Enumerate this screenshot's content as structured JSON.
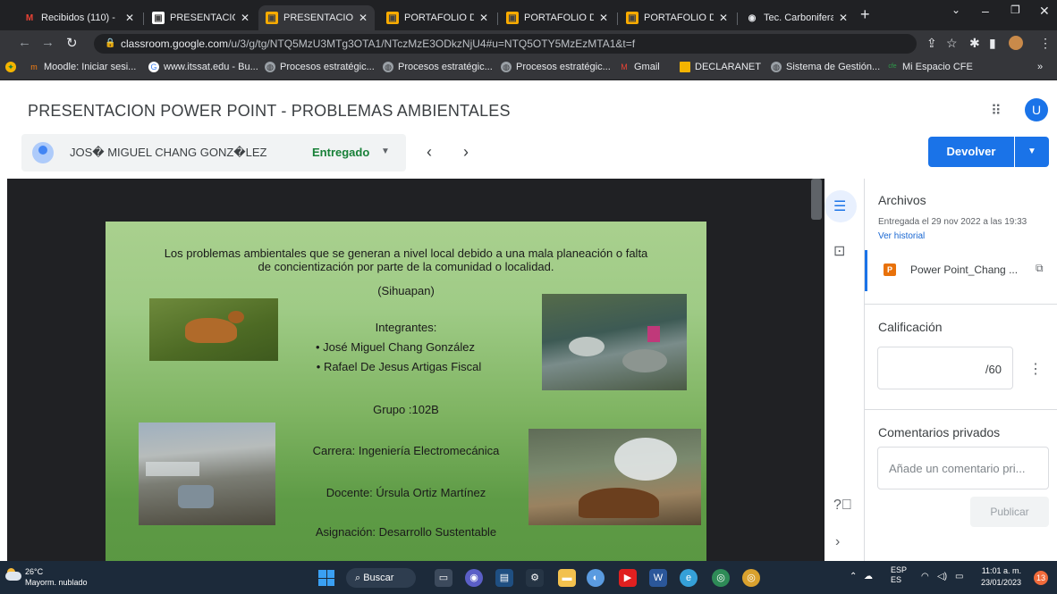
{
  "browser": {
    "tabs": [
      {
        "label": "Recibidos (110) -",
        "icon": "gmail-icon"
      },
      {
        "label": "PRESENTACION I",
        "icon": "slides-icon"
      },
      {
        "label": "PRESENTACION I",
        "icon": "slides-icon"
      },
      {
        "label": "PORTAFOLIO DE",
        "icon": "slides-icon"
      },
      {
        "label": "PORTAFOLIO DE",
        "icon": "slides-icon"
      },
      {
        "label": "PORTAFOLIO DE",
        "icon": "slides-icon"
      },
      {
        "label": "Tec. Carbonifera",
        "icon": "globe-icon"
      }
    ],
    "url_host": "classroom.google.com",
    "url_path": "/u/3/g/tg/NTQ5MzU3MTg3OTA1/NTczMzE3ODkzNjU4#u=NTQ5OTY5MzEzMTA1&t=f",
    "bookmarks": [
      "Moodle: Iniciar sesi...",
      "www.itssat.edu - Bu...",
      "Procesos estratégic...",
      "Procesos estratégic...",
      "Procesos estratégic...",
      "Gmail",
      "DECLARANET",
      "Sistema de Gestión...",
      "Mi Espacio CFE"
    ]
  },
  "classroom": {
    "title": "PRESENTACION POWER POINT - PROBLEMAS AMBIENTALES",
    "avatar_letter": "U",
    "student_name": "JOS� MIGUEL CHANG GONZ�LEZ",
    "status": "Entregado",
    "return_button": "Devolver"
  },
  "slide": {
    "intro": "Los problemas ambientales que se generan a nivel local debido a una mala planeación o falta de concientización por parte de la comunidad o localidad.",
    "place": "(Sihuapan)",
    "members_heading": "Integrantes:",
    "members": [
      "José Miguel Chang González",
      "Rafael De Jesus Artigas Fiscal"
    ],
    "group": "Grupo :102B",
    "career": "Carrera: Ingeniería Electromecánica",
    "teacher": "Docente: Úrsula Ortiz Martínez",
    "subject": "Asignación: Desarrollo Sustentable"
  },
  "panel": {
    "files_heading": "Archivos",
    "submitted_date": "Entregada el 29 nov 2022 a las 19:33",
    "history_link": "Ver historial",
    "file_name": "Power Point_Chang ...",
    "file_badge": "P",
    "grade_heading": "Calificación",
    "grade_value": "/60",
    "comments_heading": "Comentarios privados",
    "comment_placeholder": "Añade un comentario pri...",
    "publish_button": "Publicar"
  },
  "taskbar": {
    "temperature": "26°C",
    "weather": "Mayorm. nublado",
    "search": "Buscar",
    "lang1": "ESP",
    "lang2": "ES",
    "time": "11:01 a. m.",
    "date": "23/01/2023",
    "notifications": "13"
  },
  "colors": {
    "accent": "#1a73e8",
    "status_green": "#188038",
    "slide_green": "#7fb462"
  }
}
